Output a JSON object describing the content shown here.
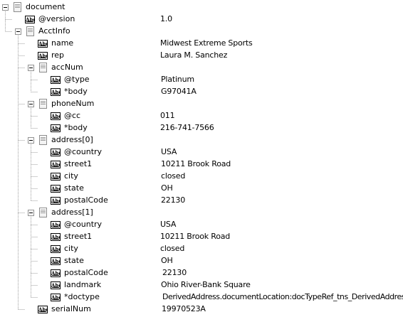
{
  "tree": {
    "nodes": [
      {
        "label": "document",
        "value": "",
        "type": "element",
        "expanded": true
      },
      {
        "label": "@version",
        "value": "1.0",
        "type": "text"
      },
      {
        "label": "AcctInfo",
        "value": "",
        "type": "element",
        "expanded": true
      },
      {
        "label": "name",
        "value": "Midwest Extreme Sports",
        "type": "text"
      },
      {
        "label": "rep",
        "value": "Laura M. Sanchez",
        "type": "text"
      },
      {
        "label": "accNum",
        "value": "",
        "type": "element",
        "expanded": true
      },
      {
        "label": "@type",
        "value": "Platinum",
        "type": "text"
      },
      {
        "label": "*body",
        "value": "G97041A",
        "type": "text"
      },
      {
        "label": "phoneNum",
        "value": "",
        "type": "element",
        "expanded": true
      },
      {
        "label": "@cc",
        "value": "011",
        "type": "text"
      },
      {
        "label": "*body",
        "value": "216-741-7566",
        "type": "text"
      },
      {
        "label": "address[0]",
        "value": "",
        "type": "element",
        "expanded": true
      },
      {
        "label": "@country",
        "value": "USA",
        "type": "text"
      },
      {
        "label": "street1",
        "value": "10211 Brook Road",
        "type": "text"
      },
      {
        "label": "city",
        "value": "closed",
        "type": "text"
      },
      {
        "label": "state",
        "value": "OH",
        "type": "text"
      },
      {
        "label": "postalCode",
        "value": "22130",
        "type": "text"
      },
      {
        "label": "address[1]",
        "value": "",
        "type": "element",
        "expanded": true
      },
      {
        "label": "@country",
        "value": "USA",
        "type": "text"
      },
      {
        "label": "street1",
        "value": "10211 Brook Road",
        "type": "text"
      },
      {
        "label": "city",
        "value": "closed",
        "type": "text"
      },
      {
        "label": "state",
        "value": "OH",
        "type": "text"
      },
      {
        "label": "postalCode",
        "value": "22130",
        "type": "text"
      },
      {
        "label": "landmark",
        "value": "Ohio River-Bank Square",
        "type": "text"
      },
      {
        "label": "*doctype",
        "value": "DerivedAddress.documentLocation:docTypeRef_tns_DerivedAddress",
        "type": "text"
      },
      {
        "label": "serialNum",
        "value": "19970523A",
        "type": "text"
      }
    ]
  },
  "icons": {
    "element": "document-node-icon",
    "text": "text-abc-icon",
    "toggle": "collapse-minus-icon"
  },
  "colors": {
    "background": "#ffffff",
    "text": "#000000",
    "tree_lines": "#a0a0a0",
    "toggle_border": "#919191"
  }
}
